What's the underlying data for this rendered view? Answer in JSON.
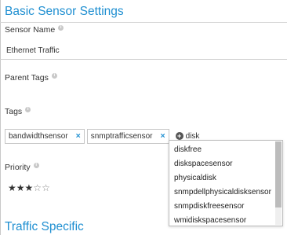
{
  "basic": {
    "title": "Basic Sensor Settings",
    "sensor_name": {
      "label": "Sensor Name",
      "value": "Ethernet Traffic"
    },
    "parent_tags": {
      "label": "Parent Tags"
    },
    "tags": {
      "label": "Tags",
      "items": [
        "bandwidthsensor",
        "snmptrafficsensor"
      ],
      "remove_glyph": "×",
      "input_value": "disk",
      "suggestions": [
        "diskfree",
        "diskspacesensor",
        "physicaldisk",
        "snmpdellphysicaldisksensor",
        "snmpdiskfreesensor",
        "wmidiskspacesensor"
      ]
    },
    "priority": {
      "label": "Priority",
      "rating": 3,
      "max": 5
    }
  },
  "traffic": {
    "title": "Traffic Specific"
  },
  "icons": {
    "info": "info-icon",
    "add": "add-icon",
    "remove": "close-icon",
    "star": "star-icon"
  },
  "colors": {
    "accent": "#1f8fd1"
  }
}
